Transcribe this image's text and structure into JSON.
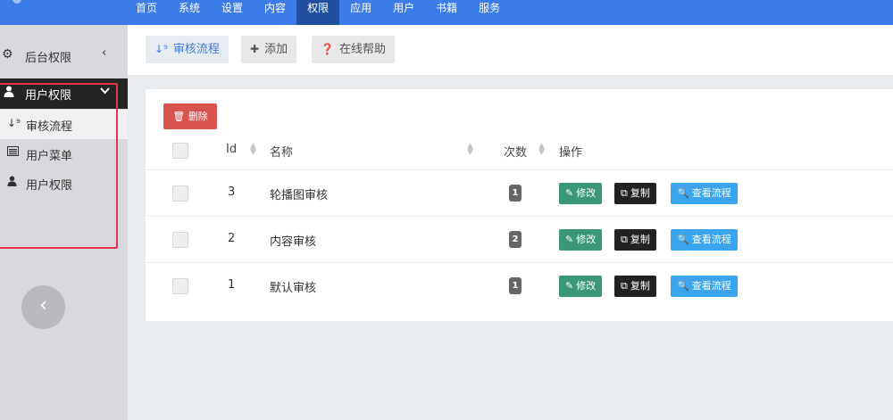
{
  "top_nav": [
    {
      "label": "首页"
    },
    {
      "label": "系统"
    },
    {
      "label": "设置"
    },
    {
      "label": "内容"
    },
    {
      "label": "权限",
      "active": true
    },
    {
      "label": "应用"
    },
    {
      "label": "用户"
    },
    {
      "label": "书籍"
    },
    {
      "label": "服务"
    }
  ],
  "sidebar": {
    "header_label": "后台权限",
    "group_label": "用户权限",
    "items": [
      {
        "label": "审核流程",
        "icon": "sort-numeric-icon",
        "active": true
      },
      {
        "label": "用户菜单",
        "icon": "list-card-icon"
      },
      {
        "label": "用户权限",
        "icon": "user-icon"
      }
    ],
    "collapse_symbol": "‹"
  },
  "toolbar": {
    "tab_label": "审核流程",
    "add_label": "添加",
    "help_label": "在线帮助"
  },
  "table": {
    "delete_label": "删除",
    "headers": {
      "id": "Id",
      "name": "名称",
      "count": "次数",
      "ops": "操作"
    },
    "rows": [
      {
        "id": "3",
        "name": "轮播图审核",
        "count": "1"
      },
      {
        "id": "2",
        "name": "内容审核",
        "count": "2"
      },
      {
        "id": "1",
        "name": "默认审核",
        "count": "1"
      }
    ],
    "actions": {
      "edit": "修改",
      "copy": "复制",
      "view": "查看流程"
    }
  },
  "colors": {
    "topbar": "#3c7ce8",
    "edit": "#3b977a",
    "copy": "#222222",
    "view": "#3aa4ee",
    "delete": "#d9534f",
    "highlight": "#e0344f"
  }
}
